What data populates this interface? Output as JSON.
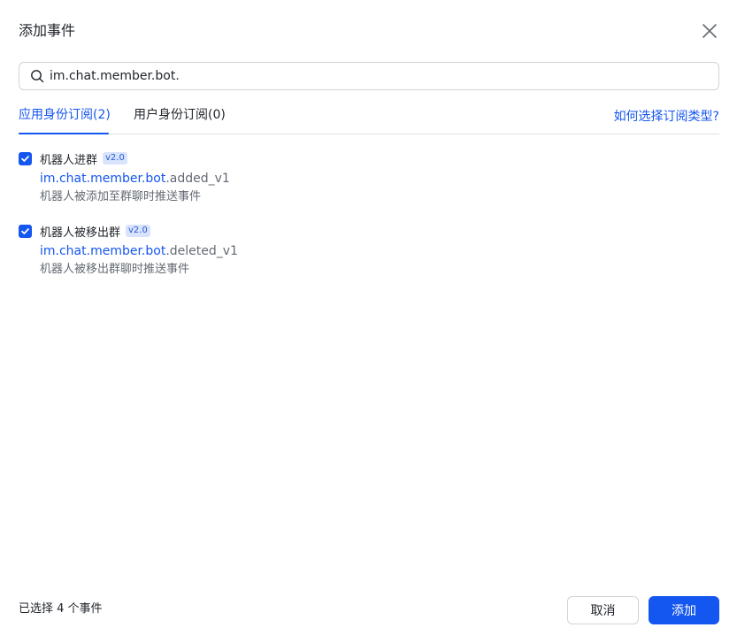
{
  "dialog": {
    "title": "添加事件",
    "close_icon": "close-icon"
  },
  "search": {
    "value": "im.chat.member.bot.",
    "icon": "search-icon"
  },
  "tabs": [
    {
      "label": "应用身份订阅(2)",
      "active": true
    },
    {
      "label": "用户身份订阅(0)",
      "active": false
    }
  ],
  "help_link": "如何选择订阅类型?",
  "events": [
    {
      "name": "机器人进群",
      "version": "v2.0",
      "key_highlight": "im.chat.member.bot",
      "key_rest": ".added_v1",
      "description": "机器人被添加至群聊时推送事件",
      "checked": true
    },
    {
      "name": "机器人被移出群",
      "version": "v2.0",
      "key_highlight": "im.chat.member.bot",
      "key_rest": ".deleted_v1",
      "description": "机器人被移出群聊时推送事件",
      "checked": true
    }
  ],
  "footer": {
    "status": "已选择 4 个事件",
    "cancel_label": "取消",
    "add_label": "添加"
  },
  "colors": {
    "accent": "#1456f0",
    "text": "#1f2329",
    "secondary_text": "#646a73",
    "badge_bg": "#d9e3fc"
  }
}
